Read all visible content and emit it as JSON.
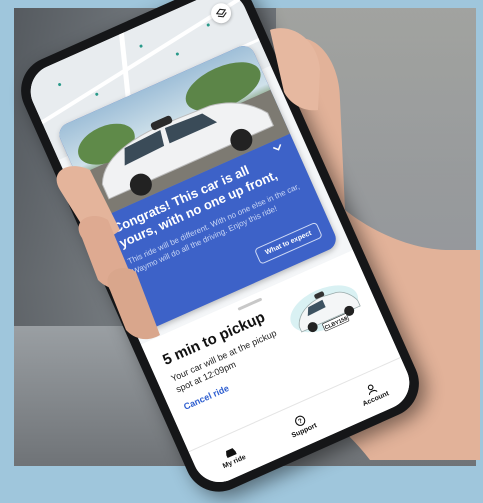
{
  "card": {
    "title": "Congrats! This car is all yours, with no one up front,",
    "body": "This ride will be different. With no one else in the car, Waymo will do all the driving. Enjoy this ride!",
    "button": "What to expect"
  },
  "pickup": {
    "title": "5 min to pickup",
    "subtitle": "Your car will be at the pickup spot at 12:09pm",
    "cancel": "Cancel ride",
    "plate": "CLBY158"
  },
  "tabs": [
    {
      "label": "My ride",
      "icon": "car-icon"
    },
    {
      "label": "Support",
      "icon": "help-icon"
    },
    {
      "label": "Account",
      "icon": "person-icon"
    }
  ],
  "colors": {
    "card_blue": "#3d62c8",
    "link_blue": "#2f5fd0",
    "map_accent": "#2a9a8a"
  }
}
